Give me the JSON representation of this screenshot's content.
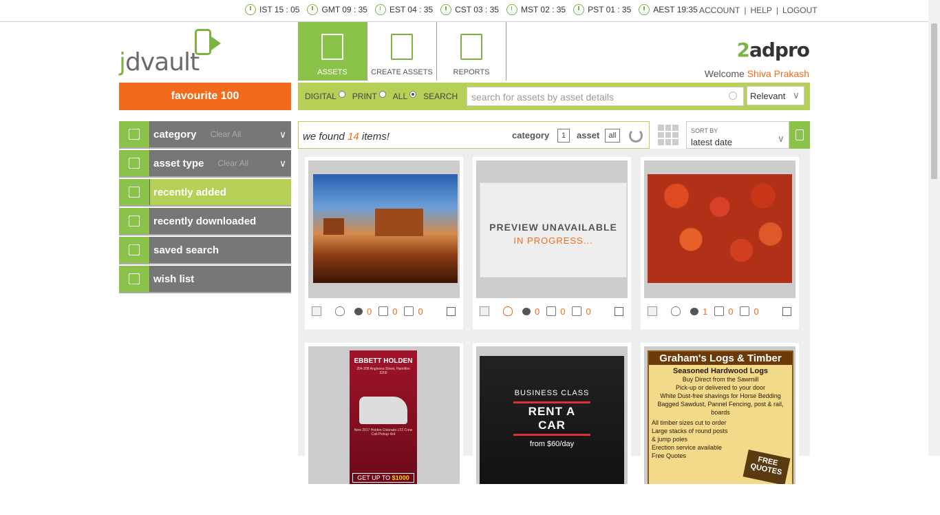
{
  "clocks": [
    {
      "label": "IST 15 : 05"
    },
    {
      "label": "GMT 09 : 35"
    },
    {
      "label": "EST 04 : 35"
    },
    {
      "label": "CST 03 : 35"
    },
    {
      "label": "MST 02 : 35"
    },
    {
      "label": "PST 01 : 35"
    },
    {
      "label": "AEST 19:35"
    }
  ],
  "toplinks": {
    "account": "ACCOUNT",
    "help": "HELP",
    "logout": "LOGOUT",
    "sep": "|"
  },
  "logo": {
    "text_a": "j",
    "text_b": "d",
    "text_c": "vault"
  },
  "favourite": "favourite 100",
  "sidebar": {
    "items": [
      {
        "label": "category",
        "clear": "Clear All",
        "icon": "layers-icon"
      },
      {
        "label": "asset type",
        "clear": "Clear All",
        "icon": "tray-icon"
      },
      {
        "label": "recently added",
        "icon": "plus-icon"
      },
      {
        "label": "recently downloaded",
        "icon": "download-icon"
      },
      {
        "label": "saved search",
        "icon": "saved-search-icon"
      },
      {
        "label": "wish list",
        "icon": "wishlist-icon"
      }
    ]
  },
  "nav": {
    "tabs": [
      {
        "label": "ASSETS",
        "icon": "document-list-icon"
      },
      {
        "label": "CREATE ASSETS",
        "icon": "edit-document-icon"
      },
      {
        "label": "REPORTS",
        "icon": "chart-icon"
      }
    ]
  },
  "brand": {
    "two": "2",
    "rest": "adpro"
  },
  "welcome": {
    "prefix": "Welcome",
    "user": "Shiva Prakash"
  },
  "filter": {
    "digital": "DIGITAL",
    "print": "PRINT",
    "all": "ALL",
    "search": "SEARCH",
    "selected": "ALL",
    "search_placeholder": "search for assets by asset details",
    "sort_relevance": "Relevant"
  },
  "found": {
    "prefix": "we found",
    "count": "14",
    "suffix": "items!",
    "category_label": "category",
    "category_count": "1",
    "asset_label": "asset",
    "asset_value": "all"
  },
  "sort": {
    "label": "SORT BY",
    "value": "latest date"
  },
  "cards": [
    {
      "type": "image",
      "art": "desert",
      "bulb_active": false,
      "hearts": "0",
      "likes": "0",
      "dislikes": "0"
    },
    {
      "type": "preview",
      "preview_title": "PREVIEW UNAVAILABLE",
      "preview_sub": "IN PROGRESS...",
      "bulb_active": true,
      "hearts": "0",
      "likes": "0",
      "dislikes": "0"
    },
    {
      "type": "image",
      "art": "apples",
      "bulb_active": false,
      "hearts": "1",
      "likes": "0",
      "dislikes": "0"
    },
    {
      "type": "ad",
      "art": "holden",
      "title": "EBBETT HOLDEN",
      "addr": "204-208 Anglesea Street, Hamilton 3200",
      "blurb": "New 2017 Holden Colorado LTZ Crew Cab Pickup 4x4",
      "cta_prefix": "GET UP TO",
      "cta_amount": "$1000"
    },
    {
      "type": "ad",
      "art": "car",
      "class": "BUSINESS CLASS",
      "headline": "RENT A CAR",
      "from": "from $60/day"
    },
    {
      "type": "ad",
      "art": "logs",
      "title": "Graham's Logs & Timber",
      "sub": "Seasoned Hardwood Logs",
      "lines": [
        "Buy Direct from the Sawmill",
        "Pick-up or delivered to your door",
        "White Dust-free shavings for Horse Bedding",
        "Bagged Sawdust, Pannel Fencing, post & rail, boards"
      ],
      "left_lines": [
        "All timber sizes cut to order",
        "Large stacks of round posts",
        "& jump poles",
        "Erection service available",
        "Free Quotes"
      ],
      "badge": "FREE QUOTES"
    }
  ]
}
